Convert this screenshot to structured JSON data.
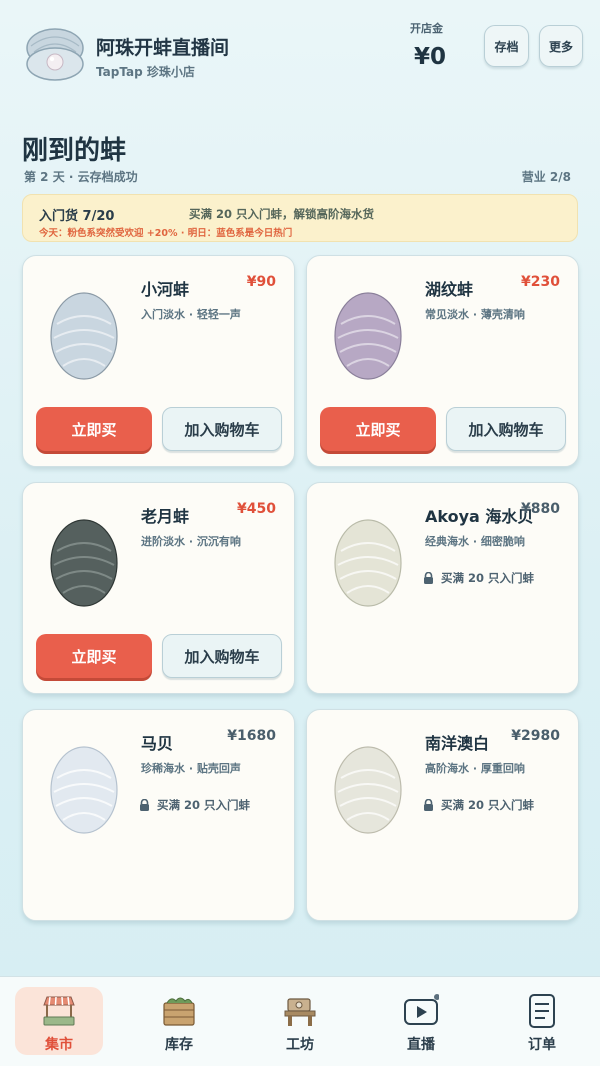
{
  "header": {
    "title": "阿珠开蚌直播间",
    "subtitle": "TapTap 珍珠小店",
    "fund_label": "开店金",
    "fund_value": "¥0",
    "save_label": "存档",
    "more_label": "更多"
  },
  "page": {
    "title": "刚到的蚌",
    "day_status": "第 2 天 · 云存档成功",
    "business": "营业 2/8"
  },
  "banner": {
    "count": "入门货 7/20",
    "tip": "买满 20 只入门蚌，解锁高阶海水货",
    "trend": "今天：粉色系突然受欢迎 +20% · 明日：蓝色系是今日热门"
  },
  "buttons": {
    "buy": "立即买",
    "cart": "加入购物车"
  },
  "products": [
    {
      "name": "小河蚌",
      "price": "¥90",
      "desc": "入门淡水 · 轻轻一声",
      "locked": false,
      "lock_text": "",
      "shell_color": "#c9d6e0"
    },
    {
      "name": "湖纹蚌",
      "price": "¥230",
      "desc": "常见淡水 · 薄壳清响",
      "locked": false,
      "lock_text": "",
      "shell_color": "#b7a8c4"
    },
    {
      "name": "老月蚌",
      "price": "¥450",
      "desc": "进阶淡水 · 沉沉有响",
      "locked": false,
      "lock_text": "",
      "shell_color": "#55605e"
    },
    {
      "name": "Akoya 海水贝",
      "price": "¥880",
      "desc": "经典海水 · 细密脆响",
      "locked": true,
      "lock_text": "买满 20 只入门蚌",
      "shell_color": "#e4e4d6"
    },
    {
      "name": "马贝",
      "price": "¥1680",
      "desc": "珍稀海水 · 贴壳回声",
      "locked": true,
      "lock_text": "买满 20 只入门蚌",
      "shell_color": "#e2e9f0"
    },
    {
      "name": "南洋澳白",
      "price": "¥2980",
      "desc": "高阶海水 · 厚重回响",
      "locked": true,
      "lock_text": "买满 20 只入门蚌",
      "shell_color": "#e6e6dc"
    }
  ],
  "nav": [
    {
      "label": "集市",
      "icon": "market-stall-icon",
      "active": true
    },
    {
      "label": "库存",
      "icon": "crate-icon",
      "active": false
    },
    {
      "label": "工坊",
      "icon": "workshop-icon",
      "active": false
    },
    {
      "label": "直播",
      "icon": "live-play-icon",
      "active": false
    },
    {
      "label": "订单",
      "icon": "order-list-icon",
      "active": false
    }
  ],
  "colors": {
    "accent_red": "#e95f4c",
    "price_red": "#e0503a",
    "banner_bg": "#fbf1cc",
    "active_tab_bg": "#fbe4d9"
  }
}
